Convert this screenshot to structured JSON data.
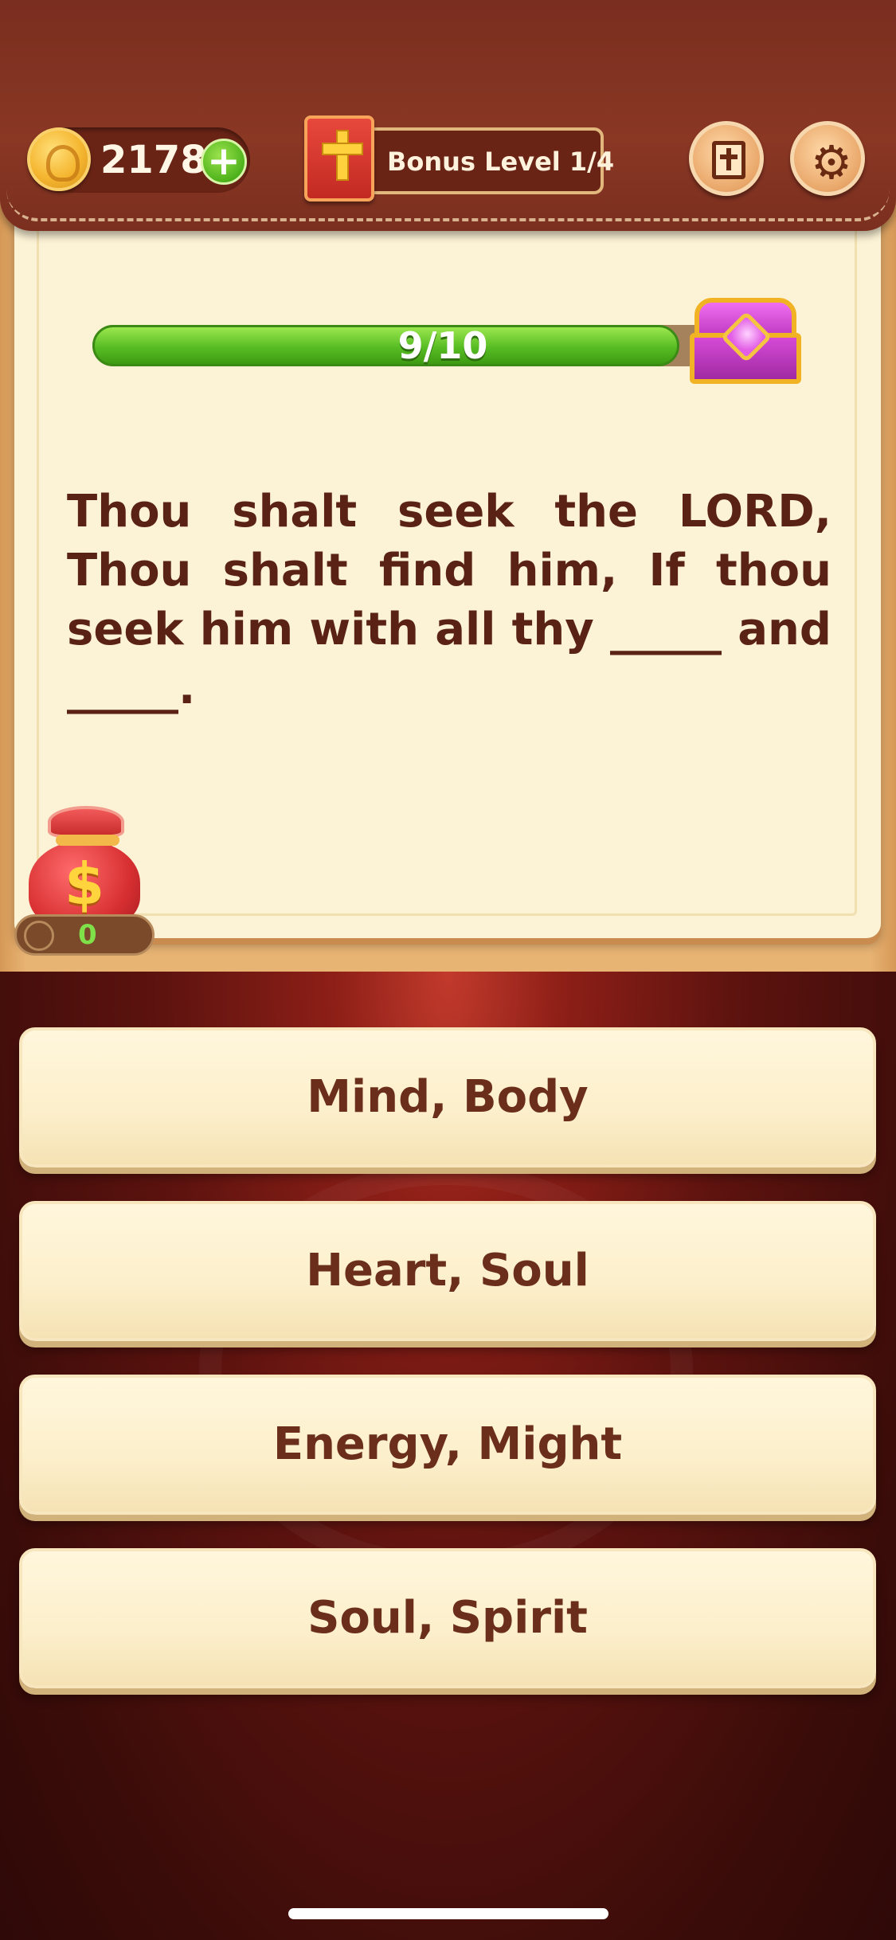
{
  "header": {
    "coins": "2178",
    "bonus_level": "Bonus Level 1/4",
    "icons": {
      "coin": "coin-icon",
      "add": "plus-icon",
      "bible": "bible-icon",
      "book_button": "book-icon",
      "settings_button": "gear-icon"
    }
  },
  "progress": {
    "label": "9/10",
    "current": 9,
    "total": 10,
    "fill_fraction": 0.9,
    "reward_icon": "treasure-chest-icon"
  },
  "question": {
    "text": "Thou shalt seek the LORD, Thou shalt find him, If thou seek him with all thy _____ and _____."
  },
  "bag": {
    "icon": "money-bag-icon",
    "count": "0"
  },
  "answers": [
    {
      "label": "Mind, Body"
    },
    {
      "label": "Heart, Soul"
    },
    {
      "label": "Energy, Might"
    },
    {
      "label": "Soul, Spirit"
    }
  ],
  "colors": {
    "accent_green": "#57bd23",
    "question_text": "#5a2214",
    "answer_text": "#6a2e1a",
    "header_bg": "#7a2e1f"
  }
}
